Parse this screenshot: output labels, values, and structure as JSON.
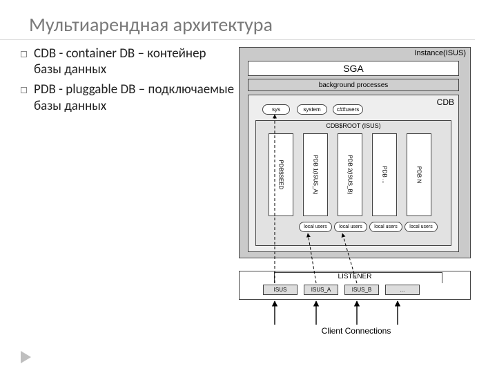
{
  "title": "Мультиарендная архитектура",
  "bullets": [
    "CDB - container DB – контейнер базы данных",
    " PDB - pluggable DB – подключаемые базы данных"
  ],
  "diagram": {
    "instance_label": "Instance(ISUS)",
    "sga": "SGA",
    "bgproc": "background processes",
    "cdb_label": "CDB",
    "common_users": {
      "sys": "sys",
      "system": "system",
      "custom": "c##users"
    },
    "cdbroot_label": "CDB$ROOT (ISUS)",
    "pdbs": [
      "PDB$SEED",
      "PDB 1(ISUS_A)",
      "PDB 2(ISUS_B)",
      "PDB ...",
      "PDB N"
    ],
    "local_users": "local users",
    "listener_label": "LISTENER",
    "services": [
      "ISUS",
      "ISUS_A",
      "ISUS_B",
      "..."
    ],
    "client_conn": "Client Connections"
  }
}
